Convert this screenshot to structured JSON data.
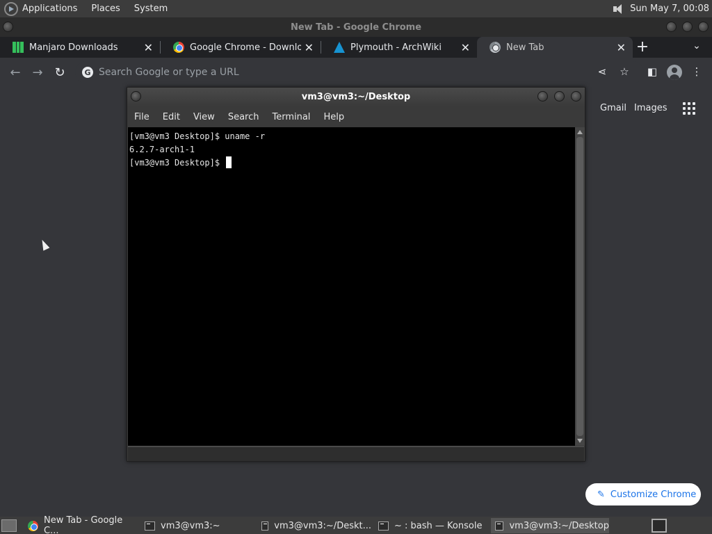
{
  "top_panel": {
    "menu": [
      "Applications",
      "Places",
      "System"
    ],
    "clock": "Sun May  7, 00:08"
  },
  "chrome": {
    "title": "New Tab - Google Chrome",
    "tabs": [
      {
        "label": "Manjaro Downloads",
        "icon": "manjaro-icon"
      },
      {
        "label": "Google Chrome - Download",
        "icon": "chrome-icon"
      },
      {
        "label": "Plymouth - ArchWiki",
        "icon": "arch-icon"
      },
      {
        "label": "New Tab",
        "icon": "chrome-icon"
      }
    ],
    "omnibox_placeholder": "Search Google or type a URL",
    "ntp": {
      "gmail": "Gmail",
      "images": "Images",
      "customize": "Customize Chrome"
    }
  },
  "terminal": {
    "title": "vm3@vm3:~/Desktop",
    "menu": [
      "File",
      "Edit",
      "View",
      "Search",
      "Terminal",
      "Help"
    ],
    "lines": [
      "[vm3@vm3 Desktop]$ uname -r",
      "6.2.7-arch1-1",
      "[vm3@vm3 Desktop]$ "
    ]
  },
  "taskbar": {
    "tasks": [
      {
        "label": "New Tab - Google C...",
        "icon": "chrome-icon"
      },
      {
        "label": "vm3@vm3:~",
        "icon": "terminal-icon"
      },
      {
        "label": "vm3@vm3:~/Deskt...",
        "icon": "terminal-icon"
      },
      {
        "label": "~ : bash — Konsole",
        "icon": "terminal-icon"
      },
      {
        "label": "vm3@vm3:~/Desktop",
        "icon": "terminal-icon"
      }
    ]
  }
}
